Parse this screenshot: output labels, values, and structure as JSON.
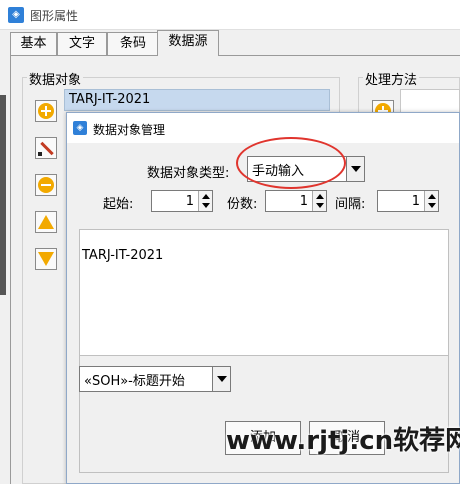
{
  "window": {
    "title": "图形属性"
  },
  "tabs": [
    {
      "label": "基本"
    },
    {
      "label": "文字"
    },
    {
      "label": "条码"
    },
    {
      "label": "数据源"
    }
  ],
  "data_objects": {
    "group_label": "数据对象",
    "selected_item": "TARJ-IT-2021"
  },
  "processing": {
    "group_label": "处理方法"
  },
  "dialog": {
    "title": "数据对象管理",
    "type_label": "数据对象类型:",
    "type_value": "手动输入",
    "start_label": "起始:",
    "start_value": "1",
    "copies_label": "份数:",
    "copies_value": "1",
    "interval_label": "间隔:",
    "interval_value": "1",
    "text_content": "TARJ-IT-2021",
    "control_char_value": "«SOH»-标题开始",
    "button_ok_partial": "添加",
    "button_cancel_partial": "取消"
  },
  "watermark": {
    "text": "www.rjtj.cn软荐网"
  },
  "colors": {
    "selection": "#c6d9ee",
    "highlight_circle": "#e0352e",
    "icon_accent": "#f2a900"
  }
}
